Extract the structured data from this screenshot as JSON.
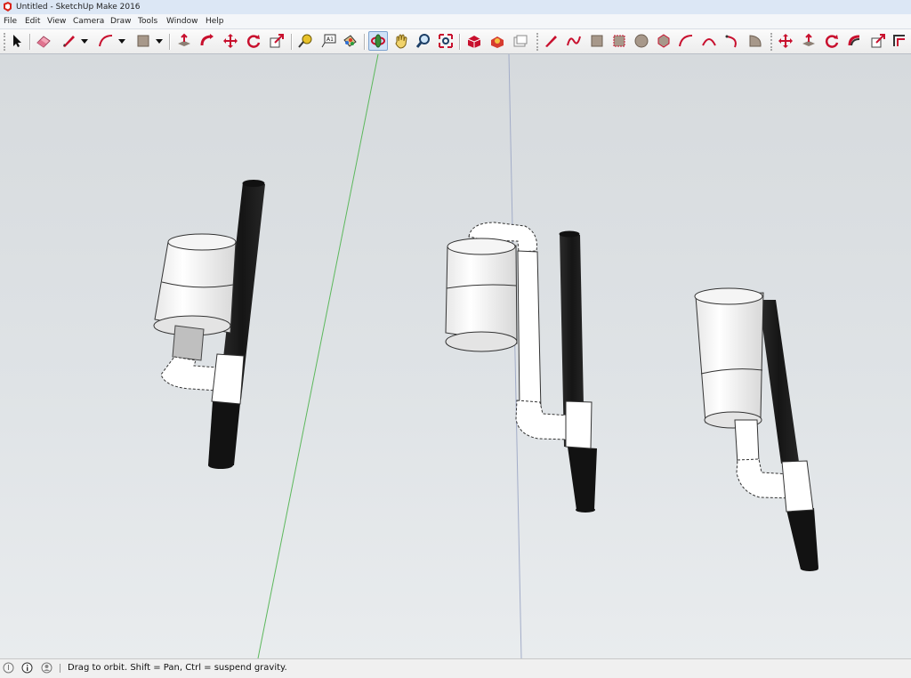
{
  "window": {
    "title": "Untitled - SketchUp Make 2016"
  },
  "menu": {
    "items": [
      "File",
      "Edit",
      "View",
      "Camera",
      "Draw",
      "Tools",
      "Window",
      "Help"
    ]
  },
  "toolbar": {
    "groups": [
      [
        "select",
        "eraser",
        "line",
        "arc",
        "rectangle"
      ],
      [
        "push-pull",
        "follow-me",
        "move",
        "rotate",
        "scale"
      ],
      [
        "tape-measure",
        "text",
        "paint-bucket"
      ],
      [
        "orbit",
        "pan",
        "zoom",
        "zoom-extents"
      ],
      [
        "warehouse",
        "extension-warehouse",
        "send-to-layout"
      ],
      [
        "pencil-line",
        "freehand",
        "rectangle-2",
        "rotated-rectangle",
        "circle",
        "polygon",
        "arc-2",
        "2-point-arc",
        "3-point-arc",
        "pie"
      ],
      [
        "move-2",
        "push-pull-2",
        "rotate-2",
        "follow-me-2",
        "scale-2",
        "offset"
      ]
    ],
    "active_tool": "orbit"
  },
  "status": {
    "message": "Drag to orbit.  Shift = Pan, Ctrl = suspend gravity."
  },
  "colors": {
    "axis_green": "#5cb85c",
    "axis_blue": "#9aa6c8",
    "tool_red": "#c8102e",
    "pipe_white": "#ffffff",
    "tube_black": "#1e1e1e"
  }
}
